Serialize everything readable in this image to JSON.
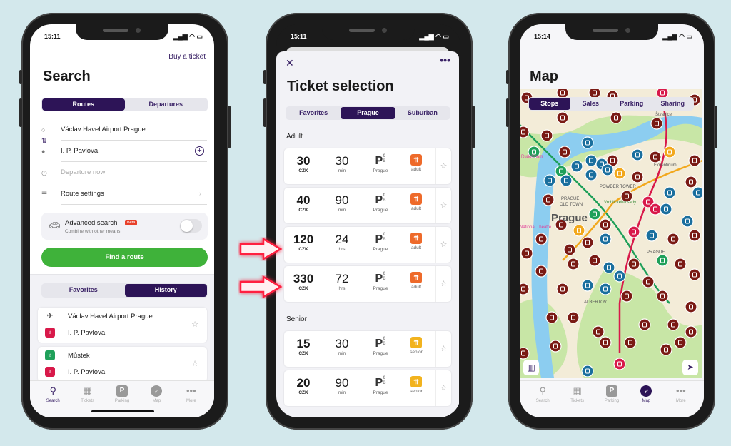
{
  "colors": {
    "accent": "#2d1457",
    "green": "#3fb23a",
    "metro_a": "#1fa05a",
    "metro_b": "#f2a81c",
    "metro_c": "#d8194a",
    "tram": "#7a1a14",
    "bus": "#1a6f9e",
    "adult": "#ee6a2a",
    "senior": "#f2b31e",
    "highlight": "#ff2040"
  },
  "search_screen": {
    "time": "15:11",
    "buy_ticket": "Buy a ticket",
    "title": "Search",
    "tabs": [
      {
        "label": "Routes",
        "active": true
      },
      {
        "label": "Departures",
        "active": false
      }
    ],
    "from": "Václav Havel Airport Prague",
    "to": "I. P. Pavlova",
    "departure_placeholder": "Departure now",
    "route_settings": "Route settings",
    "advanced": {
      "title": "Advanced search",
      "badge": "Beta",
      "subtitle": "Combine with other means",
      "enabled": false
    },
    "find_button": "Find a route",
    "list_tabs": [
      {
        "label": "Favorites",
        "active": false
      },
      {
        "label": "History",
        "active": true
      }
    ],
    "history": [
      {
        "from": "Václav Havel Airport Prague",
        "from_icon": "airplane-icon",
        "to": "I. P. Pavlova",
        "to_icon": "metro-c-icon"
      },
      {
        "from": "Můstek",
        "from_icon": "metro-a-icon",
        "to": "I. P. Pavlova",
        "to_icon": "metro-c-icon"
      }
    ]
  },
  "tabbar": [
    {
      "label": "Search",
      "icon": "search-icon"
    },
    {
      "label": "Tickets",
      "icon": "ticket-icon"
    },
    {
      "label": "Parking",
      "icon": "parking-icon"
    },
    {
      "label": "Map",
      "icon": "compass-icon"
    },
    {
      "label": "More",
      "icon": "more-icon"
    }
  ],
  "ticket_screen": {
    "time": "15:11",
    "title": "Ticket selection",
    "tabs": [
      {
        "label": "Favorites",
        "active": false
      },
      {
        "label": "Prague",
        "active": true
      },
      {
        "label": "Suburban",
        "active": false
      }
    ],
    "sections": [
      {
        "label": "Adult",
        "tickets": [
          {
            "price": "30",
            "currency": "CZK",
            "duration": "30",
            "unit": "min",
            "zone": "P",
            "zone_sup": "0",
            "zone_sub": "B",
            "zone_label": "Prague",
            "type": "adult",
            "highlighted": false
          },
          {
            "price": "40",
            "currency": "CZK",
            "duration": "90",
            "unit": "min",
            "zone": "P",
            "zone_sup": "0",
            "zone_sub": "B",
            "zone_label": "Prague",
            "type": "adult",
            "highlighted": false
          },
          {
            "price": "120",
            "currency": "CZK",
            "duration": "24",
            "unit": "hrs",
            "zone": "P",
            "zone_sup": "0",
            "zone_sub": "B",
            "zone_label": "Prague",
            "type": "adult",
            "highlighted": true
          },
          {
            "price": "330",
            "currency": "CZK",
            "duration": "72",
            "unit": "hrs",
            "zone": "P",
            "zone_sup": "0",
            "zone_sub": "B",
            "zone_label": "Prague",
            "type": "adult",
            "highlighted": true
          }
        ]
      },
      {
        "label": "Senior",
        "tickets": [
          {
            "price": "15",
            "currency": "CZK",
            "duration": "30",
            "unit": "min",
            "zone": "P",
            "zone_sup": "0",
            "zone_sub": "B",
            "zone_label": "Prague",
            "type": "senior",
            "highlighted": false
          },
          {
            "price": "20",
            "currency": "CZK",
            "duration": "90",
            "unit": "min",
            "zone": "P",
            "zone_sup": "0",
            "zone_sub": "B",
            "zone_label": "Prague",
            "type": "senior",
            "highlighted": false
          }
        ]
      }
    ]
  },
  "map_screen": {
    "time": "15:14",
    "title": "Map",
    "tabs": [
      {
        "label": "Stops",
        "active": true
      },
      {
        "label": "Sales",
        "active": false
      },
      {
        "label": "Parking",
        "active": false
      },
      {
        "label": "Sharing",
        "active": false
      }
    ],
    "labels": {
      "letenske": "Letenské sady",
      "rudolfinum": "Rudolfinum",
      "oldtown1": "PRAGUE",
      "oldtown2": "OLD TOWN",
      "city": "Prague",
      "powder": "POWDER TOWER",
      "vrchlickeho": "Vrchlického sady",
      "stvanice": "Štvanice",
      "florentinum": "Florentinum",
      "theatre": "National Theatre",
      "praha": "PRAGUE",
      "albertov": "ALBERTOV"
    },
    "active_tab": "Map"
  }
}
